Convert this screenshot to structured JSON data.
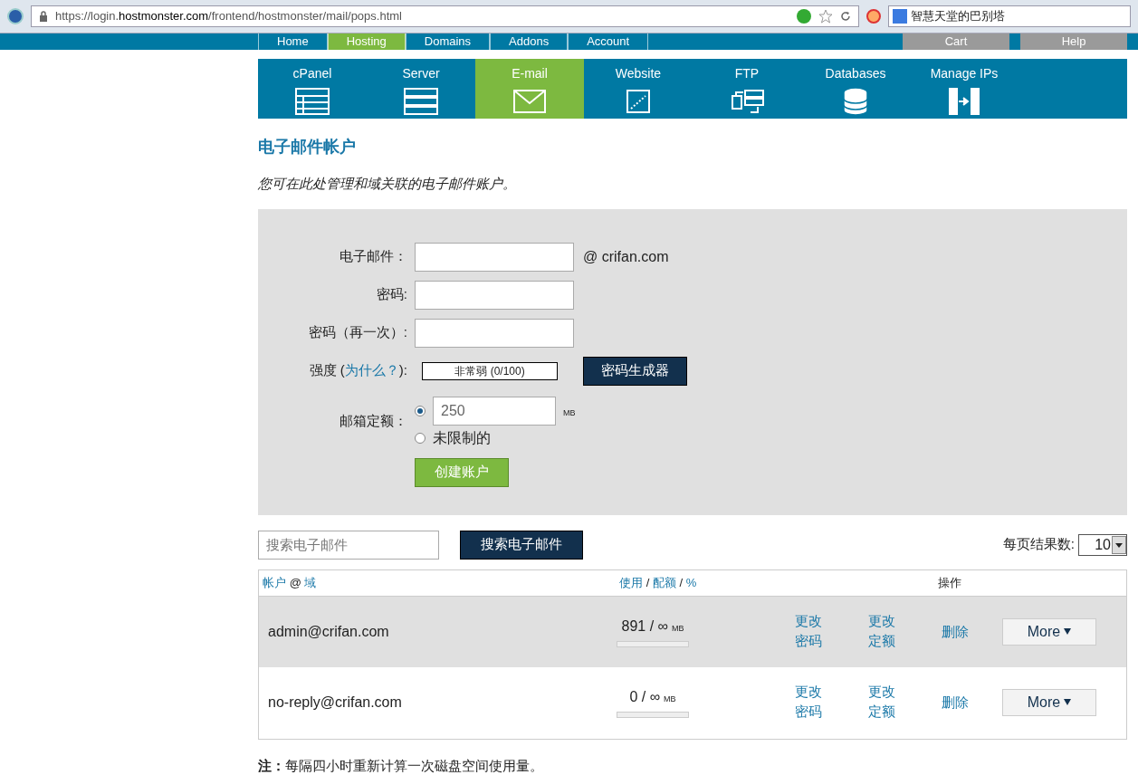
{
  "browser": {
    "url": "https://login.**hostmonster.com**/frontend/hostmonster/mail/pops.html",
    "search_value": "智慧天堂的巴别塔"
  },
  "top_nav": {
    "items": [
      {
        "label": "Home",
        "selected": false
      },
      {
        "label": "Hosting",
        "selected": true
      },
      {
        "label": "Domains",
        "selected": false
      },
      {
        "label": "Addons",
        "selected": false
      },
      {
        "label": "Account",
        "selected": false
      }
    ],
    "right_buttons": [
      "Cart",
      "Help"
    ]
  },
  "section_tabs": [
    {
      "label": "cPanel",
      "kind": "cpanel",
      "selected": false
    },
    {
      "label": "Server",
      "kind": "server",
      "selected": false
    },
    {
      "label": "E-mail",
      "kind": "email",
      "selected": true
    },
    {
      "label": "Website",
      "kind": "website",
      "selected": false
    },
    {
      "label": "FTP",
      "kind": "ftp",
      "selected": false
    },
    {
      "label": "Databases",
      "kind": "database",
      "selected": false
    },
    {
      "label": "Manage IPs",
      "kind": "ips",
      "selected": false
    }
  ],
  "page_title": "电子邮件帐户",
  "intro": "您可在此处管理和域关联的电子邮件账户。",
  "form": {
    "email_label": "电子邮件：",
    "domain": "@ crifan.com",
    "password_label": "密码:",
    "password_again_label": "密码（再一次）:",
    "strength_label": "强度 (",
    "strength_link": "为什么？",
    "strength_label_end": "):",
    "strength_meter": "非常弱 (0/100)",
    "generator_button": "密码生成器",
    "quota_label": "邮箱定额：",
    "quota_options": [
      {
        "kind": "amount",
        "value": "250",
        "unit": "MB",
        "selected": true
      },
      {
        "kind": "unlimited",
        "label": "未限制的",
        "selected": false
      }
    ],
    "create_button": "创建账户"
  },
  "search": {
    "placeholder": "搜索电子邮件",
    "button": "搜索电子邮件",
    "per_page_label": "每页结果数:",
    "per_page_value": "10"
  },
  "table": {
    "columns": [
      {
        "parts": [
          {
            "text": "帐户",
            "link": true
          },
          {
            "text": "@",
            "link": false
          },
          {
            "text": "域",
            "link": true
          }
        ]
      },
      {
        "parts": [
          {
            "text": "使用",
            "link": true
          },
          {
            "text": "/",
            "link": false
          },
          {
            "text": "配额",
            "link": true
          },
          {
            "text": "/",
            "link": false
          },
          {
            "text": "%",
            "link": true
          }
        ]
      },
      {
        "parts": [
          {
            "text": "操作",
            "link": false
          }
        ]
      }
    ],
    "rows": [
      {
        "account": "admin@crifan.com",
        "usage": "891 / ∞",
        "unit": "MB",
        "level": 0,
        "actions": [
          "更改密码",
          "更改定额",
          "删除"
        ],
        "more": "More",
        "selected": true
      },
      {
        "account": "no-reply@crifan.com",
        "usage": "0 / ∞",
        "unit": "MB",
        "level": 0,
        "actions": [
          "更改密码",
          "更改定额",
          "删除"
        ],
        "more": "More",
        "selected": false
      }
    ]
  },
  "note": {
    "label": "注：",
    "text": "每隔四小时重新计算一次磁盘空间使用量。"
  }
}
